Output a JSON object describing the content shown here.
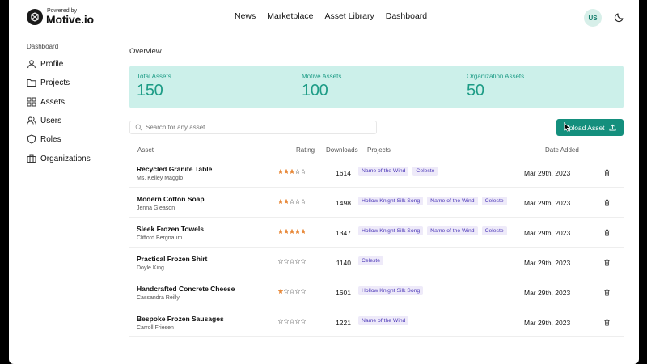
{
  "brand": {
    "powered_by": "Powered by",
    "name": "Motive.io"
  },
  "nav": [
    "News",
    "Marketplace",
    "Asset Library",
    "Dashboard"
  ],
  "user": {
    "initials": "US"
  },
  "sidebar": {
    "title": "Dashboard",
    "items": [
      {
        "label": "Profile",
        "icon": "user-icon"
      },
      {
        "label": "Projects",
        "icon": "folder-icon"
      },
      {
        "label": "Assets",
        "icon": "grid-icon"
      },
      {
        "label": "Users",
        "icon": "users-icon"
      },
      {
        "label": "Roles",
        "icon": "shield-icon"
      },
      {
        "label": "Organizations",
        "icon": "briefcase-icon"
      }
    ]
  },
  "overview": {
    "title": "Overview",
    "stats": [
      {
        "label": "Total Assets",
        "value": "150"
      },
      {
        "label": "Motive Assets",
        "value": "100"
      },
      {
        "label": "Organization Assets",
        "value": "50"
      }
    ]
  },
  "search": {
    "placeholder": "Search for any asset"
  },
  "upload_button": {
    "label": "Upload Asset"
  },
  "table": {
    "headers": {
      "asset": "Asset",
      "rating": "Rating",
      "downloads": "Downloads",
      "projects": "Projects",
      "date": "Date Added"
    },
    "rows": [
      {
        "name": "Recycled Granite Table",
        "author": "Ms. Kelley Maggio",
        "rating": 3,
        "downloads": "1614",
        "projects": [
          "Name of the Wind",
          "Celeste"
        ],
        "date": "Mar 29th, 2023"
      },
      {
        "name": "Modern Cotton Soap",
        "author": "Jenna Gleason",
        "rating": 2,
        "downloads": "1498",
        "projects": [
          "Hollow Knight Silk Song",
          "Name of the Wind",
          "Celeste"
        ],
        "date": "Mar 29th, 2023"
      },
      {
        "name": "Sleek Frozen Towels",
        "author": "Clifford Bergnaum",
        "rating": 5,
        "downloads": "1347",
        "projects": [
          "Hollow Knight Silk Song",
          "Name of the Wind",
          "Celeste"
        ],
        "date": "Mar 29th, 2023"
      },
      {
        "name": "Practical Frozen Shirt",
        "author": "Doyle King",
        "rating": 0,
        "downloads": "1140",
        "projects": [
          "Celeste"
        ],
        "date": "Mar 29th, 2023"
      },
      {
        "name": "Handcrafted Concrete Cheese",
        "author": "Cassandra Reilly",
        "rating": 1,
        "downloads": "1601",
        "projects": [
          "Hollow Knight Silk Song"
        ],
        "date": "Mar 29th, 2023"
      },
      {
        "name": "Bespoke Frozen Sausages",
        "author": "Carroll Friesen",
        "rating": 0,
        "downloads": "1221",
        "projects": [
          "Name of the Wind"
        ],
        "date": "Mar 29th, 2023"
      }
    ]
  },
  "colors": {
    "accent": "#148f7d",
    "stats_bg": "#ccf0ea",
    "star": "#e8893a",
    "tag_bg": "#eeeaf9",
    "tag_text": "#4b37b8"
  }
}
